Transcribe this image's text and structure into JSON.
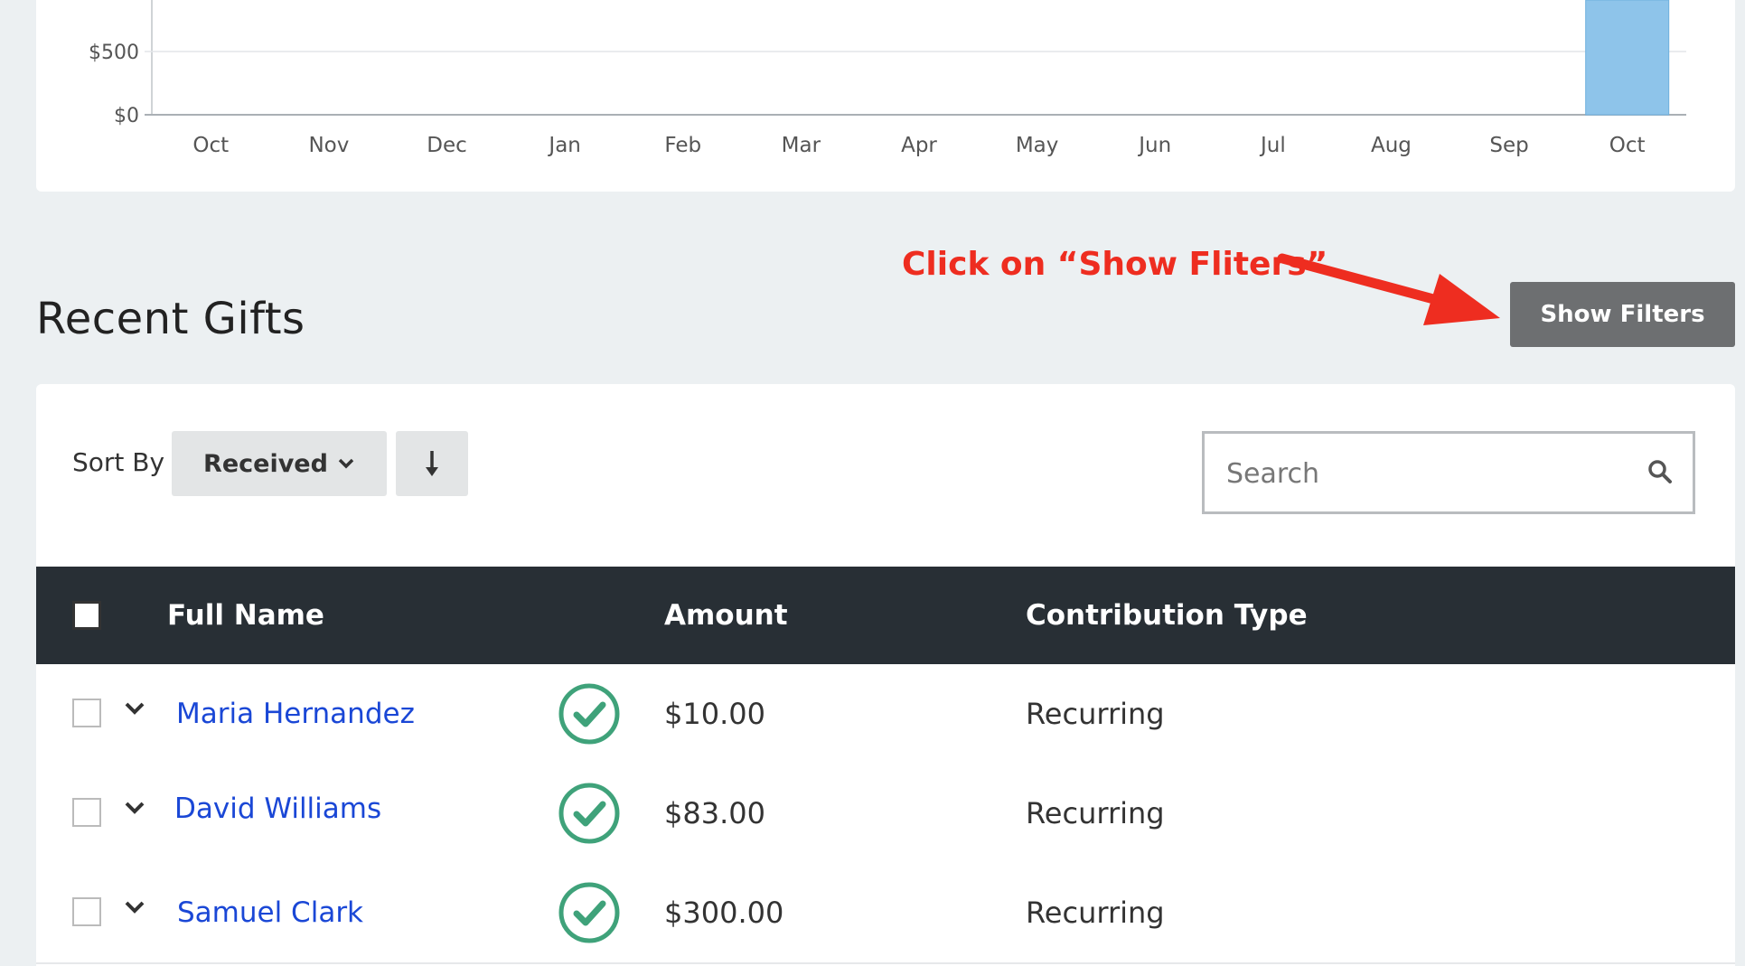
{
  "chart_data": {
    "type": "bar",
    "categories": [
      "Oct",
      "Nov",
      "Dec",
      "Jan",
      "Feb",
      "Mar",
      "Apr",
      "May",
      "Jun",
      "Jul",
      "Aug",
      "Sep",
      "Oct"
    ],
    "values": [
      0,
      0,
      0,
      0,
      0,
      0,
      0,
      0,
      0,
      0,
      0,
      0,
      1000
    ],
    "y_ticks": [
      "$0",
      "$500"
    ],
    "ylim": [
      0,
      650
    ],
    "grid": true,
    "bar_color": "#8ec4ea"
  },
  "annotation": {
    "text": "Click on “Show Fliters”",
    "color": "#ee2d20"
  },
  "header": {
    "title": "Recent Gifts",
    "show_filters_label": "Show Filters"
  },
  "toolbar": {
    "sort_by_label": "Sort By",
    "sort_value": "Received",
    "sort_direction_icon": "arrow-down-icon",
    "search_placeholder": "Search"
  },
  "table": {
    "columns": [
      "Full Name",
      "Amount",
      "Contribution Type"
    ],
    "rows": [
      {
        "name": "Maria Hernandez",
        "amount": "$10.00",
        "type": "Recurring"
      },
      {
        "name": "David Williams",
        "amount": "$83.00",
        "type": "Recurring"
      },
      {
        "name": "Samuel Clark",
        "amount": "$300.00",
        "type": "Recurring"
      }
    ]
  },
  "colors": {
    "header_bg": "#282f35",
    "status_green": "#3fa27a",
    "link": "#1a47d6",
    "button": "#6d6f71"
  }
}
